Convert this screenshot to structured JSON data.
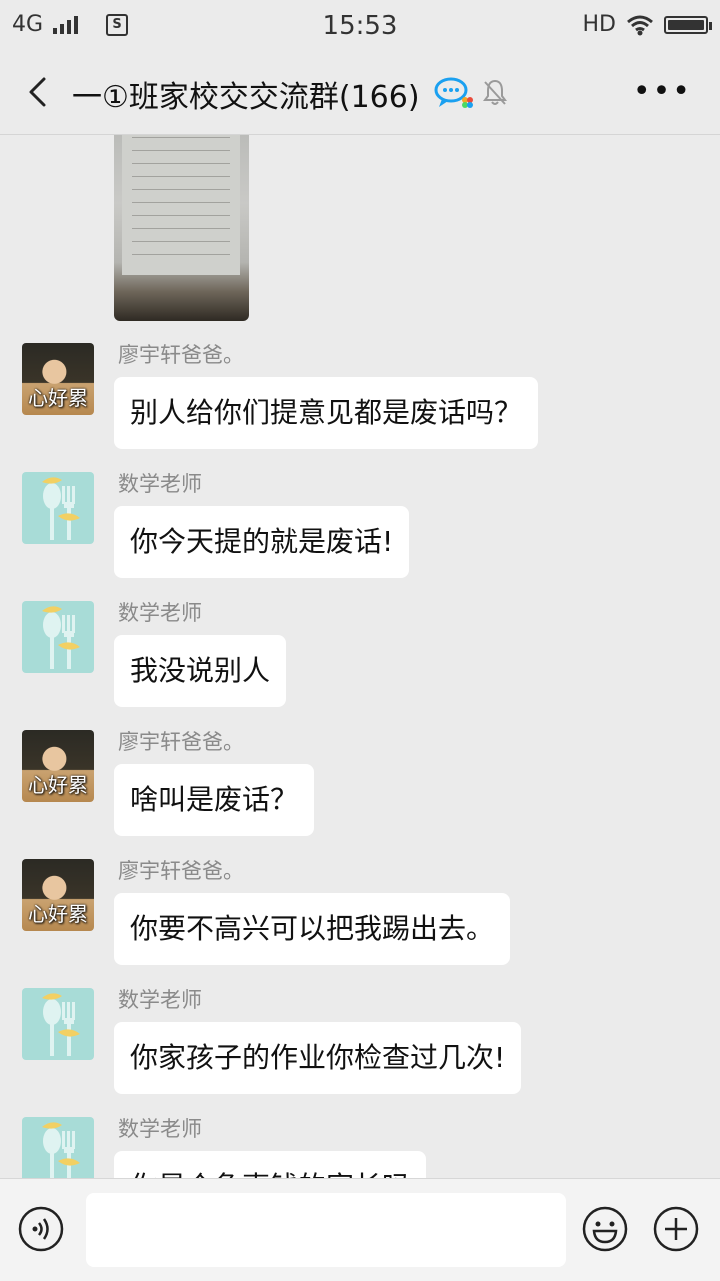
{
  "status_bar": {
    "network": "4G",
    "time": "15:53",
    "hd": "HD"
  },
  "header": {
    "title": "一①班家校交交流群(166)"
  },
  "messages": [
    {
      "sender": "廖宇轩爸爸。",
      "avatar_caption": "心好累",
      "text": "别人给你们提意见都是废话吗？"
    },
    {
      "sender": "数学老师",
      "text": "你今天提的就是废话!"
    },
    {
      "sender": "数学老师",
      "text": "我没说别人"
    },
    {
      "sender": "廖宇轩爸爸。",
      "avatar_caption": "心好累",
      "text": "啥叫是废话？"
    },
    {
      "sender": "廖宇轩爸爸。",
      "avatar_caption": "心好累",
      "text": "你要不高兴可以把我踢出去。"
    },
    {
      "sender": "数学老师",
      "text": "你家孩子的作业你检查过几次!"
    },
    {
      "sender": "数学老师",
      "text": "你是个急事钱的家长吗"
    }
  ],
  "input": {
    "placeholder": ""
  },
  "colors": {
    "background": "#ebebeb",
    "bubble": "#ffffff",
    "sender_name": "#8a8a8a",
    "accent": "#1aa0f0"
  }
}
